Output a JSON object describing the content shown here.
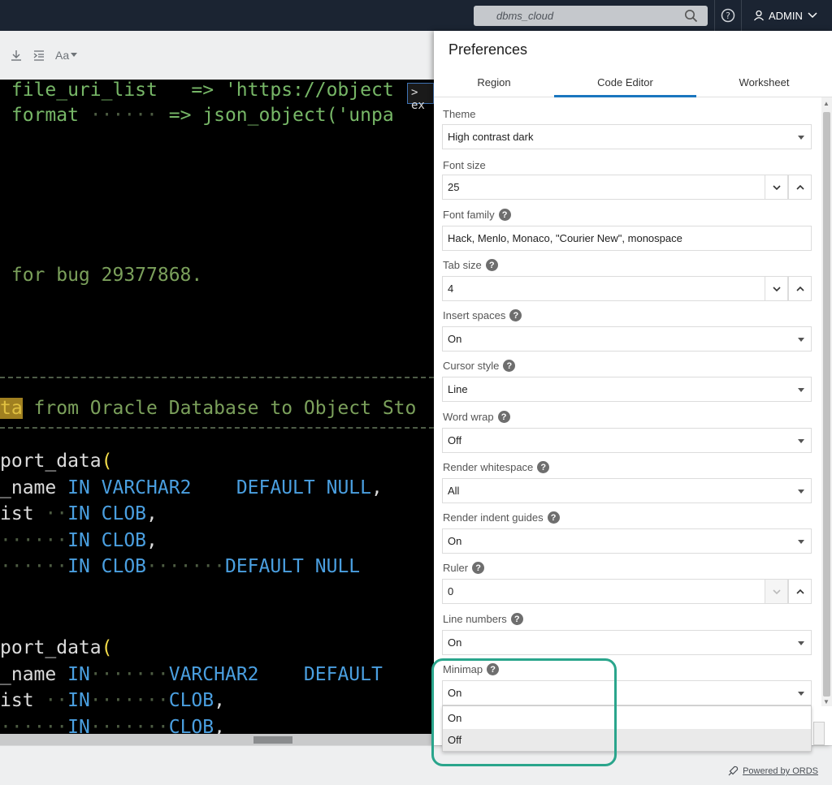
{
  "header": {
    "search_placeholder": "dbms_cloud",
    "user_label": "ADMIN"
  },
  "editor": {
    "toolbar_font_label": "Aa",
    "suggest_text": "ex",
    "lines": [
      {
        "parts": [
          {
            "t": " file_uri_list  ",
            "c": "c-green"
          },
          {
            "t": " => ",
            "c": "c-green"
          },
          {
            "t": "'https://object",
            "c": "c-green"
          }
        ]
      },
      {
        "parts": [
          {
            "t": " format ",
            "c": "c-green"
          },
          {
            "t": "······",
            "c": "c-dim"
          },
          {
            "t": " => json_object('unpa",
            "c": "c-green"
          }
        ]
      },
      {
        "parts": [
          {
            "t": " for bug 29377868.",
            "c": "c-comment"
          }
        ]
      },
      {
        "parts": [
          {
            "t": "ta",
            "c": "hl"
          },
          {
            "t": " from Oracle Database to Object Sto",
            "c": "c-comment"
          }
        ]
      },
      {
        "parts": [
          {
            "t": "port_data",
            "c": "c-white"
          },
          {
            "t": "(",
            "c": "c-yellow"
          }
        ]
      },
      {
        "parts": [
          {
            "t": "_name ",
            "c": "c-white"
          },
          {
            "t": "IN VARCHAR2",
            "c": "c-blue"
          },
          {
            "t": "   ",
            "c": "c-dim"
          },
          {
            "t": " DEFAULT NULL",
            "c": "c-blue"
          },
          {
            "t": ",",
            "c": "c-white"
          }
        ]
      },
      {
        "parts": [
          {
            "t": "ist ",
            "c": "c-white"
          },
          {
            "t": "··",
            "c": "c-dim"
          },
          {
            "t": "IN CLOB",
            "c": "c-blue"
          },
          {
            "t": ",",
            "c": "c-white"
          }
        ]
      },
      {
        "parts": [
          {
            "t": "······",
            "c": "c-dim"
          },
          {
            "t": "IN CLOB",
            "c": "c-blue"
          },
          {
            "t": ",",
            "c": "c-white"
          }
        ]
      },
      {
        "parts": [
          {
            "t": "······",
            "c": "c-dim"
          },
          {
            "t": "IN CLOB",
            "c": "c-blue"
          },
          {
            "t": "·······",
            "c": "c-dim"
          },
          {
            "t": "DEFAULT NULL",
            "c": "c-blue"
          }
        ]
      },
      {
        "parts": [
          {
            "t": "port_data",
            "c": "c-white"
          },
          {
            "t": "(",
            "c": "c-yellow"
          }
        ]
      },
      {
        "parts": [
          {
            "t": "_name ",
            "c": "c-white"
          },
          {
            "t": "IN",
            "c": "c-blue"
          },
          {
            "t": "·······",
            "c": "c-dim"
          },
          {
            "t": "VARCHAR2",
            "c": "c-blue"
          },
          {
            "t": "   ",
            "c": "c-dim"
          },
          {
            "t": " DEFAULT",
            "c": "c-blue"
          }
        ]
      },
      {
        "parts": [
          {
            "t": "ist ",
            "c": "c-white"
          },
          {
            "t": "··",
            "c": "c-dim"
          },
          {
            "t": "IN",
            "c": "c-blue"
          },
          {
            "t": "·······",
            "c": "c-dim"
          },
          {
            "t": "CLOB",
            "c": "c-blue"
          },
          {
            "t": ",",
            "c": "c-white"
          }
        ]
      },
      {
        "parts": [
          {
            "t": "······",
            "c": "c-dim"
          },
          {
            "t": "IN",
            "c": "c-blue"
          },
          {
            "t": "·······",
            "c": "c-dim"
          },
          {
            "t": "CLOB",
            "c": "c-blue"
          },
          {
            "t": ",",
            "c": "c-white"
          }
        ]
      }
    ]
  },
  "preferences": {
    "title": "Preferences",
    "tabs": [
      "Region",
      "Code Editor",
      "Worksheet"
    ],
    "fields": {
      "theme": {
        "label": "Theme",
        "value": "High contrast dark"
      },
      "font_size": {
        "label": "Font size",
        "value": "25"
      },
      "font_family": {
        "label": "Font family",
        "value": "Hack, Menlo, Monaco, \"Courier New\", monospace"
      },
      "tab_size": {
        "label": "Tab size",
        "value": "4"
      },
      "insert_spaces": {
        "label": "Insert spaces",
        "value": "On"
      },
      "cursor_style": {
        "label": "Cursor style",
        "value": "Line"
      },
      "word_wrap": {
        "label": "Word wrap",
        "value": "Off"
      },
      "render_whitespace": {
        "label": "Render whitespace",
        "value": "All"
      },
      "render_indent_guides": {
        "label": "Render indent guides",
        "value": "On"
      },
      "ruler": {
        "label": "Ruler",
        "value": "0"
      },
      "line_numbers": {
        "label": "Line numbers",
        "value": "On"
      },
      "minimap": {
        "label": "Minimap",
        "value": "On"
      }
    },
    "minimap_options": [
      "On",
      "Off"
    ],
    "help_glyph": "?"
  },
  "footer": {
    "powered_by": "Powered by ORDS"
  },
  "colors": {
    "accent": "#1a76bf",
    "callout": "#2aa58c",
    "topbar": "#1b2432"
  }
}
